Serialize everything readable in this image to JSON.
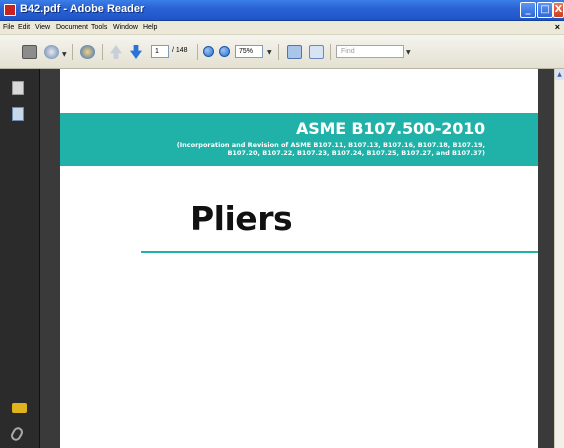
{
  "window": {
    "title": "B42.pdf - Adobe Reader",
    "min_glyph": "_",
    "max_glyph": "□",
    "close_glyph": "X"
  },
  "menu": {
    "items": [
      "File",
      "Edit",
      "View",
      "Document",
      "Tools",
      "Window",
      "Help"
    ],
    "close_glyph": "×"
  },
  "toolbar": {
    "page_current": "1",
    "page_total": "/ 148",
    "zoom": "75%",
    "find_placeholder": "Find",
    "icons": [
      "print-icon",
      "email-icon",
      "collaborate-icon",
      "prev-page-icon",
      "next-page-icon",
      "zoom-out-icon",
      "zoom-in-icon",
      "fit-page-icon",
      "full-screen-icon"
    ]
  },
  "navpane": {
    "icons": [
      "pages-icon",
      "bookmarks-icon",
      "signatures-icon",
      "attachments-icon"
    ]
  },
  "document": {
    "standard": "ASME B107.500-2010",
    "subtitle_line1": "(Incorporation and Revision of ASME B107.11, B107.13, B107.16, B107.18, B107.19,",
    "subtitle_line2": "B107.20, B107.22, B107.23, B107.24, B107.25, B107.27, and B107.37)",
    "title": "Pliers"
  },
  "colors": {
    "accent_teal": "#20b2a8",
    "titlebar_blue": "#2a63d6",
    "navpane_bg": "#2b2b2b"
  }
}
